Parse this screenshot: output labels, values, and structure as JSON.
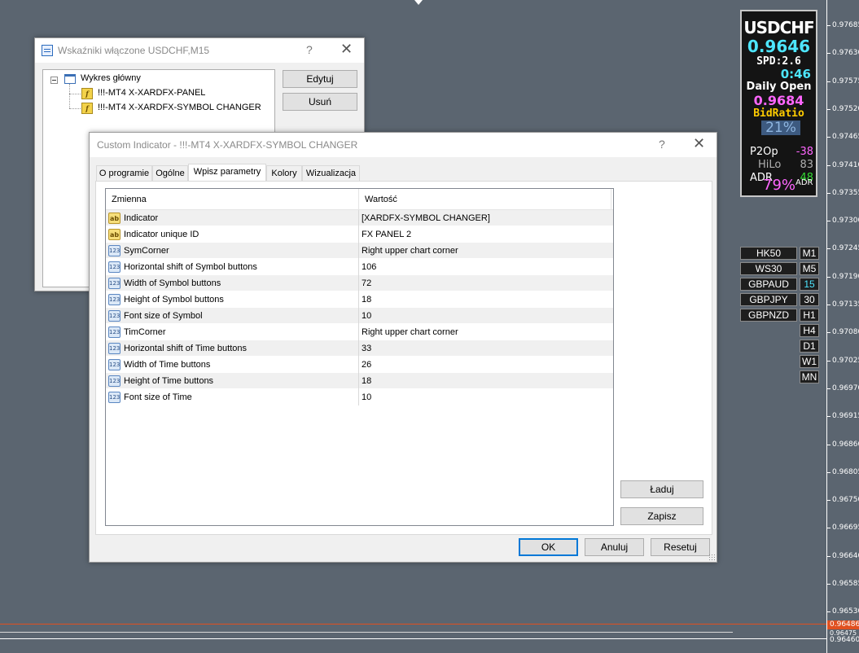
{
  "price_axis": {
    "ticks": [
      "0.97685",
      "0.97630",
      "0.97575",
      "0.97520",
      "0.97465",
      "0.97410",
      "0.97355",
      "0.97300",
      "0.97245",
      "0.97190",
      "0.97135",
      "0.97080",
      "0.97025",
      "0.96970",
      "0.96915",
      "0.96860",
      "0.96805",
      "0.96750",
      "0.96695",
      "0.96640",
      "0.96585",
      "0.96530"
    ],
    "current_tag": "0.96486",
    "tag2": "0.96475",
    "bottom": "0.96460"
  },
  "panel": {
    "symbol": "USDCHF",
    "bid": "0.9646",
    "spread": "SPD:2.6",
    "timer": "0:46",
    "daily_open_label": "Daily Open",
    "daily_open_value": "0.9684",
    "bid_ratio_label": "BidRatio",
    "bid_ratio_value": "21%",
    "rows": [
      {
        "label": "P2Op",
        "value": "-38",
        "color": "#ff66ff"
      },
      {
        "label": "HiLo",
        "value": "83",
        "color": "#b0b0b0"
      },
      {
        "label": "ADR",
        "value": "48",
        "color": "#33dd33"
      }
    ],
    "adr_pct": "79%",
    "adr_pct_label": "ADR"
  },
  "symbol_buttons": [
    "HK50",
    "WS30",
    "GBPAUD",
    "GBPJPY",
    "GBPNZD"
  ],
  "tf_buttons": [
    "M1",
    "M5",
    "15",
    "30",
    "H1",
    "H4",
    "D1",
    "W1",
    "MN"
  ],
  "tf_active": "15",
  "indicators_window": {
    "title": "Wskaźniki włączone USDCHF,M15",
    "help": "?",
    "close": "✕",
    "tree": {
      "root": "Wykres główny",
      "children": [
        "!!!-MT4 X-XARDFX-PANEL",
        "!!!-MT4 X-XARDFX-SYMBOL CHANGER"
      ]
    },
    "edit_button": "Edytuj",
    "delete_button": "Usuń"
  },
  "custom_window": {
    "title": "Custom Indicator - !!!-MT4 X-XARDFX-SYMBOL CHANGER",
    "help": "?",
    "close": "✕",
    "tabs": [
      "O programie",
      "Ogólne",
      "Wpisz parametry",
      "Kolory",
      "Wizualizacja"
    ],
    "active_tab": "Wpisz parametry",
    "grid": {
      "col_name": "Zmienna",
      "col_value": "Wartość",
      "rows": [
        {
          "type": "ab",
          "name": "Indicator",
          "value": "[XARDFX-SYMBOL CHANGER]"
        },
        {
          "type": "ab",
          "name": "Indicator unique ID",
          "value": "FX PANEL 2"
        },
        {
          "type": "123",
          "name": "SymCorner",
          "value": "Right upper chart corner"
        },
        {
          "type": "123",
          "name": "Horizontal shift of Symbol buttons",
          "value": "106"
        },
        {
          "type": "123",
          "name": "Width of Symbol buttons",
          "value": "72"
        },
        {
          "type": "123",
          "name": "Height of Symbol buttons",
          "value": "18"
        },
        {
          "type": "123",
          "name": "Font size of Symbol",
          "value": "10"
        },
        {
          "type": "123",
          "name": "TimCorner",
          "value": "Right upper chart corner"
        },
        {
          "type": "123",
          "name": "Horizontal shift of Time buttons",
          "value": "33"
        },
        {
          "type": "123",
          "name": "Width of Time buttons",
          "value": "26"
        },
        {
          "type": "123",
          "name": "Height of Time buttons",
          "value": "18"
        },
        {
          "type": "123",
          "name": "Font size of Time",
          "value": "10"
        }
      ],
      "icon_ab": "ab",
      "icon_123": "123"
    },
    "load_button": "Ładuj",
    "save_button": "Zapisz",
    "ok_button": "OK",
    "cancel_button": "Anuluj",
    "reset_button": "Resetuj"
  }
}
